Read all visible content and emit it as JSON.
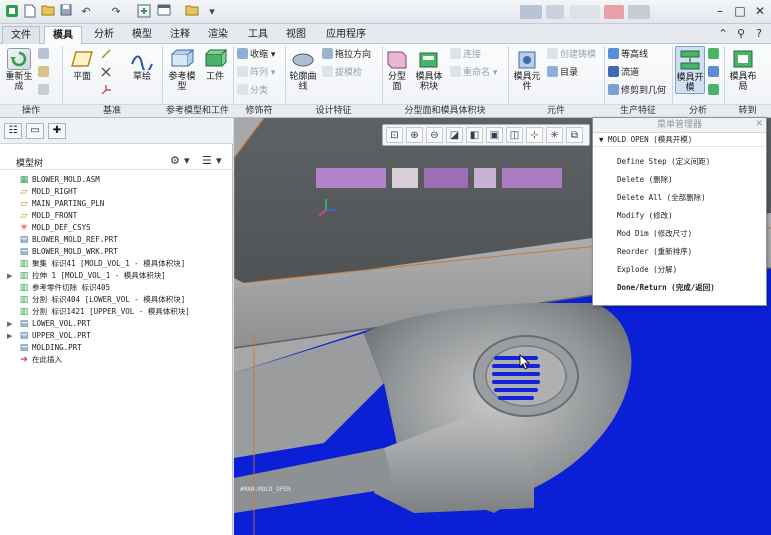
{
  "tabs": {
    "file": "文件",
    "items": [
      "模具",
      "分析",
      "模型",
      "注释",
      "渲染",
      "工具",
      "视图",
      "应用程序"
    ],
    "active_index": 0
  },
  "ribbon": {
    "groups": {
      "operations": "操作",
      "datum": "基准",
      "ref_model_workpiece": "参考模型和工件",
      "modifiers": "修饰符",
      "design_features": "设计特征",
      "parting_surface": "分型面和模具体积块",
      "components": "元件",
      "production_features": "生产特征",
      "analysis": "分析",
      "go_to": "转到"
    },
    "buttons": {
      "regenerate": "重新生成",
      "plane": "平面",
      "sketch": "草绘",
      "ref_model": "参考模型",
      "workpiece": "工件",
      "shrink": "收缩",
      "pattern": "阵列",
      "split": "分类",
      "contour_curve": "轮廓曲线",
      "draft_direction": "拖拉方向",
      "draft_detect": "拔模检",
      "parting_surface": "分型面",
      "mold_volume": "模具体积块",
      "connect": "连接",
      "rename": "重命名",
      "mold_component": "模具元件",
      "create_casting": "创建铸模",
      "catalog": "目录",
      "contour_line": "等高线",
      "runner": "流道",
      "trim_to_geom": "修剪到几何",
      "mold_open": "模具开模",
      "mold_layout": "模具布局"
    }
  },
  "model_tree": {
    "title": "模型树",
    "items": [
      {
        "icon": "assembly",
        "label": "BLOWER_MOLD.ASM",
        "expandable": false
      },
      {
        "icon": "datum-plane",
        "label": "MOLD_RIGHT",
        "expandable": false
      },
      {
        "icon": "datum-plane",
        "label": "MAIN_PARTING_PLN",
        "expandable": false
      },
      {
        "icon": "datum-plane",
        "label": "MOLD_FRONT",
        "expandable": false
      },
      {
        "icon": "csys",
        "label": "MOLD_DEF_CSYS",
        "expandable": false
      },
      {
        "icon": "part",
        "label": "BLOWER_MOLD_REF.PRT",
        "expandable": false
      },
      {
        "icon": "part",
        "label": "BLOWER_MOLD_WRK.PRT",
        "expandable": false
      },
      {
        "icon": "feature",
        "label": "聚集 标识41 [MOLD_VOL_1 - 模具体积块]",
        "expandable": false
      },
      {
        "icon": "feature",
        "label": "拉伸 1 [MOLD_VOL_1 - 模具体积块]",
        "expandable": true
      },
      {
        "icon": "feature",
        "label": "参考零件切除 标识405",
        "expandable": false
      },
      {
        "icon": "feature",
        "label": "分割 标识404 [LOWER_VOL - 模具体积块]",
        "expandable": false
      },
      {
        "icon": "feature",
        "label": "分割 标识1421 [UPPER_VOL - 模具体积块]",
        "expandable": false
      },
      {
        "icon": "part",
        "label": "LOWER_VOL.PRT",
        "expandable": true
      },
      {
        "icon": "part",
        "label": "UPPER_VOL.PRT",
        "expandable": true
      },
      {
        "icon": "part",
        "label": "MOLDING.PRT",
        "expandable": false
      },
      {
        "icon": "insert-here",
        "label": "在此插入",
        "expandable": false
      }
    ]
  },
  "viewport": {
    "status_text": "#MAN:MOLD_OPEN"
  },
  "menu_manager": {
    "title": "菜单管理器",
    "submenu": "MOLD OPEN (模具开模)",
    "items": [
      "Define Step (定义间距)",
      "Delete (删除)",
      "Delete All (全部删除)",
      "Modify (修改)",
      "Mod Dim (修改尺寸)",
      "Reorder (重新排序)",
      "Explode (分解)",
      "Done/Return (完成/返回)"
    ]
  },
  "colors": {
    "mold_blue": "#0a1fd6",
    "mold_gray": "#8f9294",
    "accent_green": "#2e9e4e",
    "blur_purple": "#b184c9"
  }
}
